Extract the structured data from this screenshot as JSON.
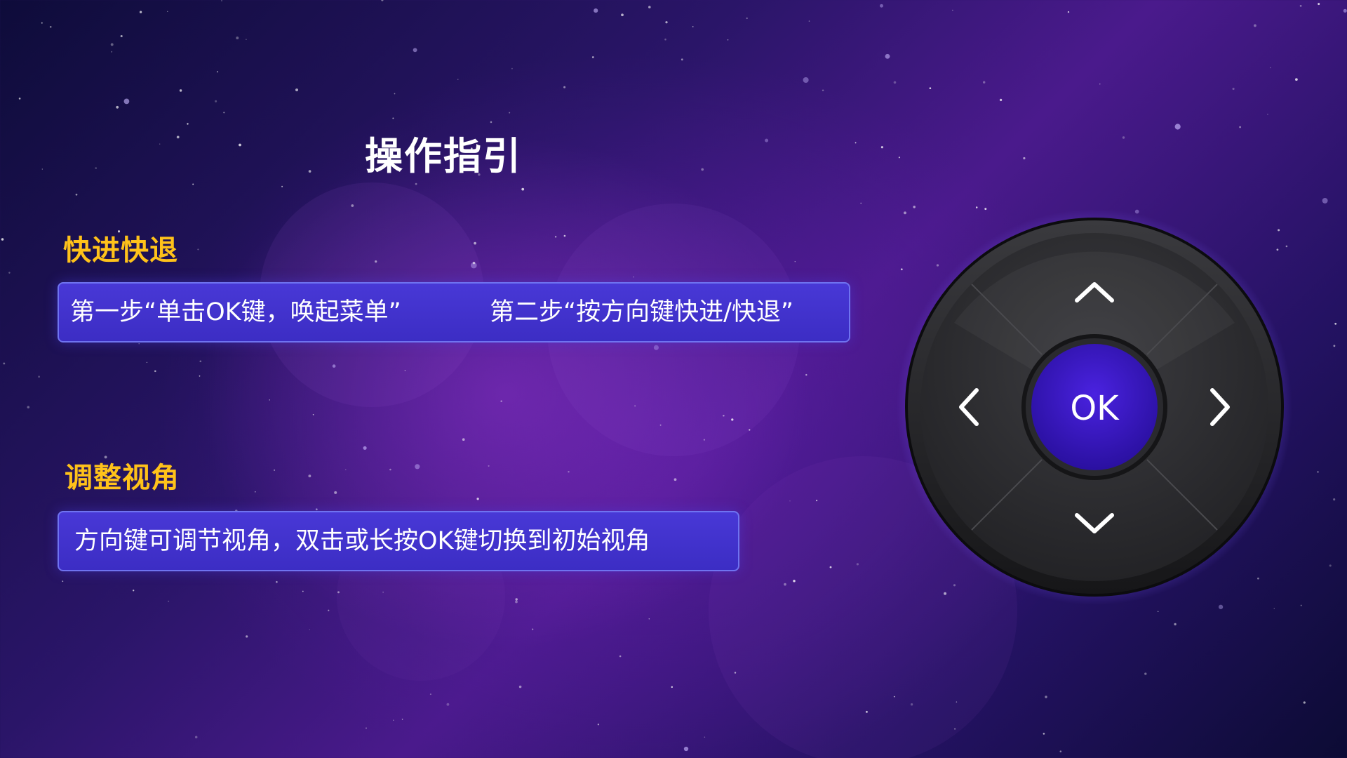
{
  "page_title": "操作指引",
  "sections": [
    {
      "title": "快进快退",
      "steps": [
        "第一步“单击OK键，唤起菜单”",
        "第二步“按方向键快进/快退”"
      ]
    },
    {
      "title": "调整视角",
      "steps": [
        "方向键可调节视角，双击或长按OK键切换到初始视角"
      ]
    }
  ],
  "remote": {
    "ok_label": "OK",
    "icons": [
      "arrow-up-icon",
      "arrow-down-icon",
      "arrow-left-icon",
      "arrow-right-icon"
    ]
  },
  "colors": {
    "section_title": "#ffc21a",
    "info_box": "#4435cf",
    "info_box_border": "#6f73f0",
    "ok_button": "#3f18c8",
    "dpad_body": "#2b2b2e"
  }
}
